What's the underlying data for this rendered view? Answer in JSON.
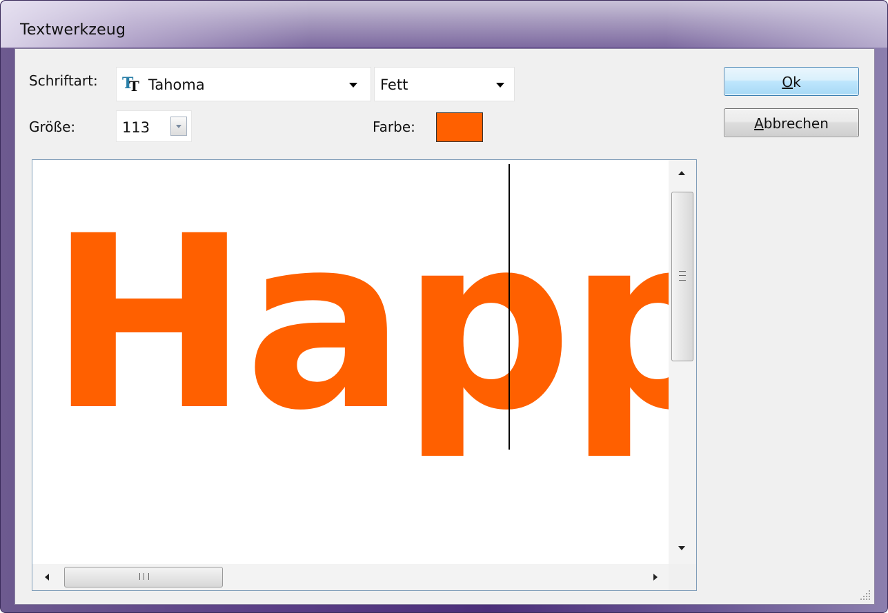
{
  "window": {
    "title": "Textwerkzeug"
  },
  "font": {
    "label": "Schriftart:",
    "family": "Tahoma",
    "style": "Fett",
    "icon": "truetype-font-icon"
  },
  "size": {
    "label": "Größe:",
    "value": "113"
  },
  "color": {
    "label": "Farbe:",
    "value": "#ff6000"
  },
  "buttons": {
    "ok_access": "O",
    "ok_rest": "k",
    "cancel_access": "A",
    "cancel_rest": "bbrechen"
  },
  "preview": {
    "text": "Happy"
  },
  "scrollbars": {
    "vertical_position": 0.0,
    "horizontal_position": 0.0,
    "horizontal_grip": "III"
  }
}
